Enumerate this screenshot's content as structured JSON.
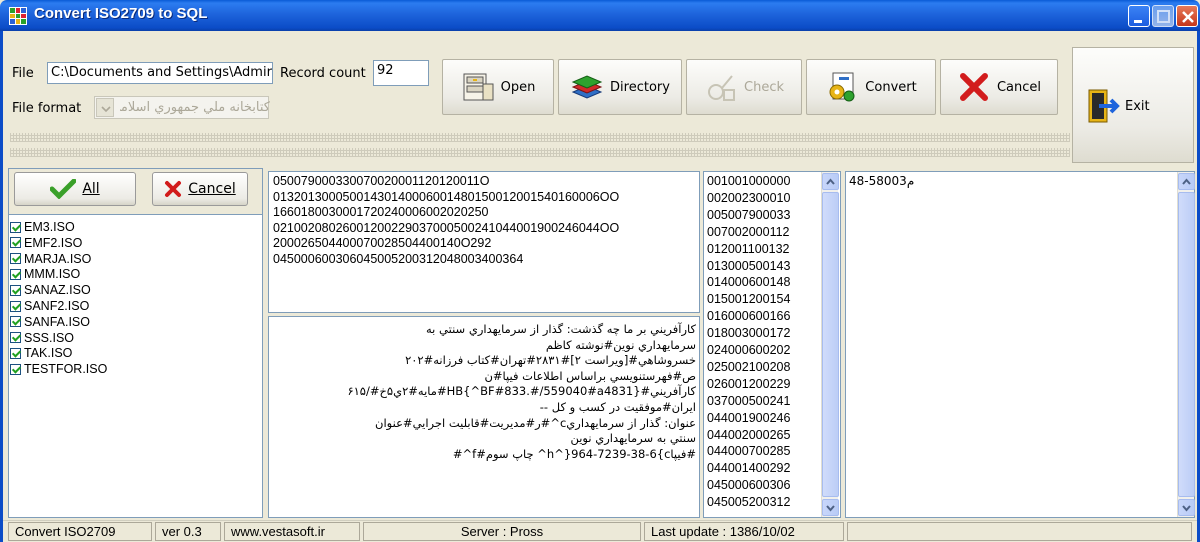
{
  "window": {
    "title": "Convert ISO2709 to SQL",
    "icon": "app-grid-icon"
  },
  "toolbar": {
    "file_label": "File",
    "file_value": "C:\\Documents and Settings\\Admir",
    "record_count_label": "Record count",
    "record_count_value": "92",
    "file_format_label": "File format",
    "file_format_value": "کتابخانه ملي جمهوري اسلامي",
    "open_label": "Open",
    "directory_label": "Directory",
    "check_label": "Check",
    "convert_label": "Convert",
    "cancel_label": "Cancel",
    "exit_label": "Exit"
  },
  "left_panel": {
    "all_label": "All",
    "cancel_label": "Cancel",
    "files": [
      "EM3.ISO",
      "EMF2.ISO",
      "MARJA.ISO",
      "MMM.ISO",
      "SANAZ.ISO",
      "SANF2.ISO",
      "SANFA.ISO",
      "SSS.ISO",
      "TAK.ISO",
      "TESTFOR.ISO"
    ]
  },
  "leader_text": [
    "050079000330070020001120120011О",
    "01320130005001430140006001480150012001540160006OO",
    "1660180030001720240006002020250",
    "02100208026001200229037000500241044001900246044OO",
    "200026504400070028504400140O292",
    "045000600306045005200312048003400364"
  ],
  "record_text": [
    "کارآفريني بر ما چه گذشت: گذار از سرمايهداري سنتي به",
    "سرمايهداري نوين#نوشته کاظم",
    "خسروشاهي#[ويراست ۲]#۲۸۳۱#تهران#کتاب فرزانه#۲۰۲",
    "ص#فهرستنويسي براساس اطلاعات فيپا#ن",
    "کارآفريني#{BF#833.#/559040#a4831^}HB#مايه#۲ي۵خ#/۶۱۵",
    "ايران#موفقيت در کسب و کل --",
    "عنوان: گذار از سرمايهداريc^#ر#مديريت#قابليت اجرايي#عنوان",
    "سنتي به سرمايهداري نوين",
    "#فيپاh^}964-7239-38-6{c^ چاپ سوم#f^#"
  ],
  "directory_entries": [
    "001001000000",
    "002002300010",
    "005007900033",
    "007002000112",
    "012001100132",
    "013000500143",
    "014000600148",
    "015001200154",
    "016000600166",
    "018003000172",
    "024000600202",
    "025002100208",
    "026001200229",
    "037000500241",
    "044001900246",
    "044002000265",
    "044000700285",
    "044001400292",
    "045000600306",
    "045005200312"
  ],
  "field_value": "م58003-48",
  "status_bar": {
    "app": "Convert ISO2709",
    "version": "ver 0.3",
    "website": "www.vestasoft.ir",
    "server": "Server : Pross",
    "last_update": "Last update : 1386/10/02"
  },
  "colors": {
    "titlebar": "#0b4cc7",
    "window_bg": "#ece9d8",
    "input_border": "#7f9db9"
  }
}
